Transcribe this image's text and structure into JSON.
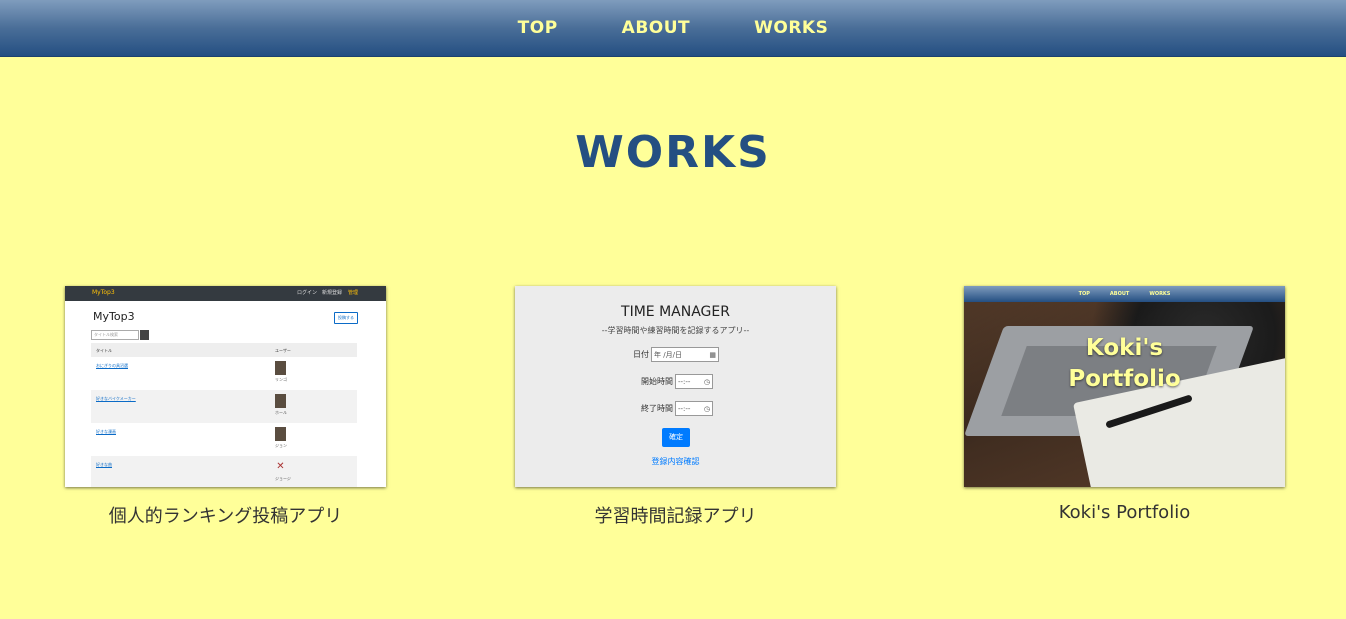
{
  "nav": {
    "links": [
      "TOP",
      "ABOUT",
      "WORKS"
    ]
  },
  "section": {
    "title": "WORKS"
  },
  "works": [
    {
      "caption": "個人的ランキング投稿アプリ",
      "thumb": {
        "brand": "MyTop3",
        "nav_links": "ログイン　新規登録",
        "nav_admin": "管理",
        "title": "MyTop3",
        "post_button": "投稿する",
        "search_placeholder": "タイトル検索",
        "headers": [
          "タイトル",
          "ユーザー"
        ],
        "rows": [
          {
            "title": "おにぎりの具沼選",
            "user": "リンゴ"
          },
          {
            "title": "好きなバイクメーカー",
            "user": "ホール"
          },
          {
            "title": "好きな漫画",
            "user": "ジョン"
          },
          {
            "title": "好きな曲",
            "user": "ジョージ"
          }
        ]
      }
    },
    {
      "caption": "学習時間記録アプリ",
      "thumb": {
        "title": "TIME MANAGER",
        "subtitle": "--学習時間や練習時間を記録するアプリ--",
        "date_label": "日付",
        "date_value": "年 /月/日",
        "start_label": "開始時間",
        "start_value": "--:--",
        "end_label": "終了時間",
        "end_value": "--:--",
        "confirm_button": "確定",
        "check_link": "登録内容確認"
      }
    },
    {
      "caption": "Koki's Portfolio",
      "thumb": {
        "nav_links": [
          "TOP",
          "ABOUT",
          "WORKS"
        ],
        "title_line1": "Koki's",
        "title_line2": "Portfolio"
      }
    }
  ],
  "colors": {
    "background": "#ffff99",
    "nav_text": "#ffff99",
    "title": "#244f82"
  }
}
